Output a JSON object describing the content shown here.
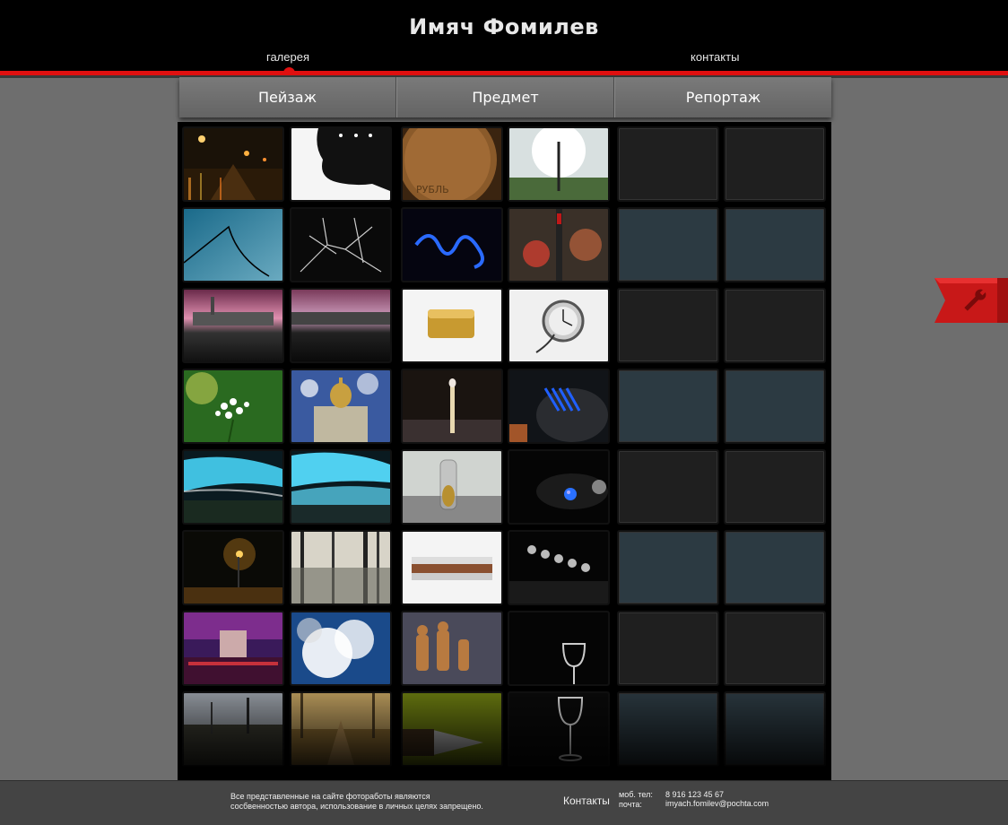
{
  "header": {
    "title": "Имяч Фомилев",
    "nav": [
      {
        "label": "галерея",
        "active": true
      },
      {
        "label": "контакты",
        "active": false
      }
    ]
  },
  "tabs": [
    "Пейзаж",
    "Предмет",
    "Репортаж"
  ],
  "colors": {
    "accent": "#e01010",
    "background": "#6e6e6e",
    "header": "#000000",
    "footer": "#444444"
  },
  "gallery": {
    "columns": [
      {
        "category": "Пейзаж",
        "thumbnails": [
          "night-street",
          "bw-trees-silhouette",
          "power-line-sky",
          "bw-branches",
          "pink-sky-reflection",
          "pink-sky-reflection-2",
          "white-flowers",
          "cathedral",
          "cyan-sky-field",
          "cyan-sky-water",
          "night-lamp",
          "flooded-forest",
          "night-arch",
          "clouds-sun",
          "railway",
          "forest-path"
        ]
      },
      {
        "category": "Предмет",
        "thumbnails": [
          "coin",
          "pen-sunlight",
          "blue-logo",
          "red-pen",
          "gold-lighter",
          "pocket-watch",
          "matchstick",
          "blue-mouse",
          "bottle-glass",
          "blue-ball",
          "harmonica",
          "chess-dark",
          "chess-pieces",
          "wine-glass",
          "knife-yellow",
          "wine-glass-2"
        ]
      },
      {
        "category": "Репортаж",
        "thumbnails": []
      }
    ]
  },
  "side_tab": {
    "icon": "wrench-icon"
  },
  "footer": {
    "note_line1": "Все представленные на сайте фотоработы являются",
    "note_line2": "сосбвенностью автора, использование в личных целях запрещено.",
    "contacts_title": "Контакты",
    "phone_label": "моб. тел:",
    "phone_value": "8 916 123 45 67",
    "email_label": "почта:",
    "email_value": "imyach.fomilev@pochta.com"
  }
}
